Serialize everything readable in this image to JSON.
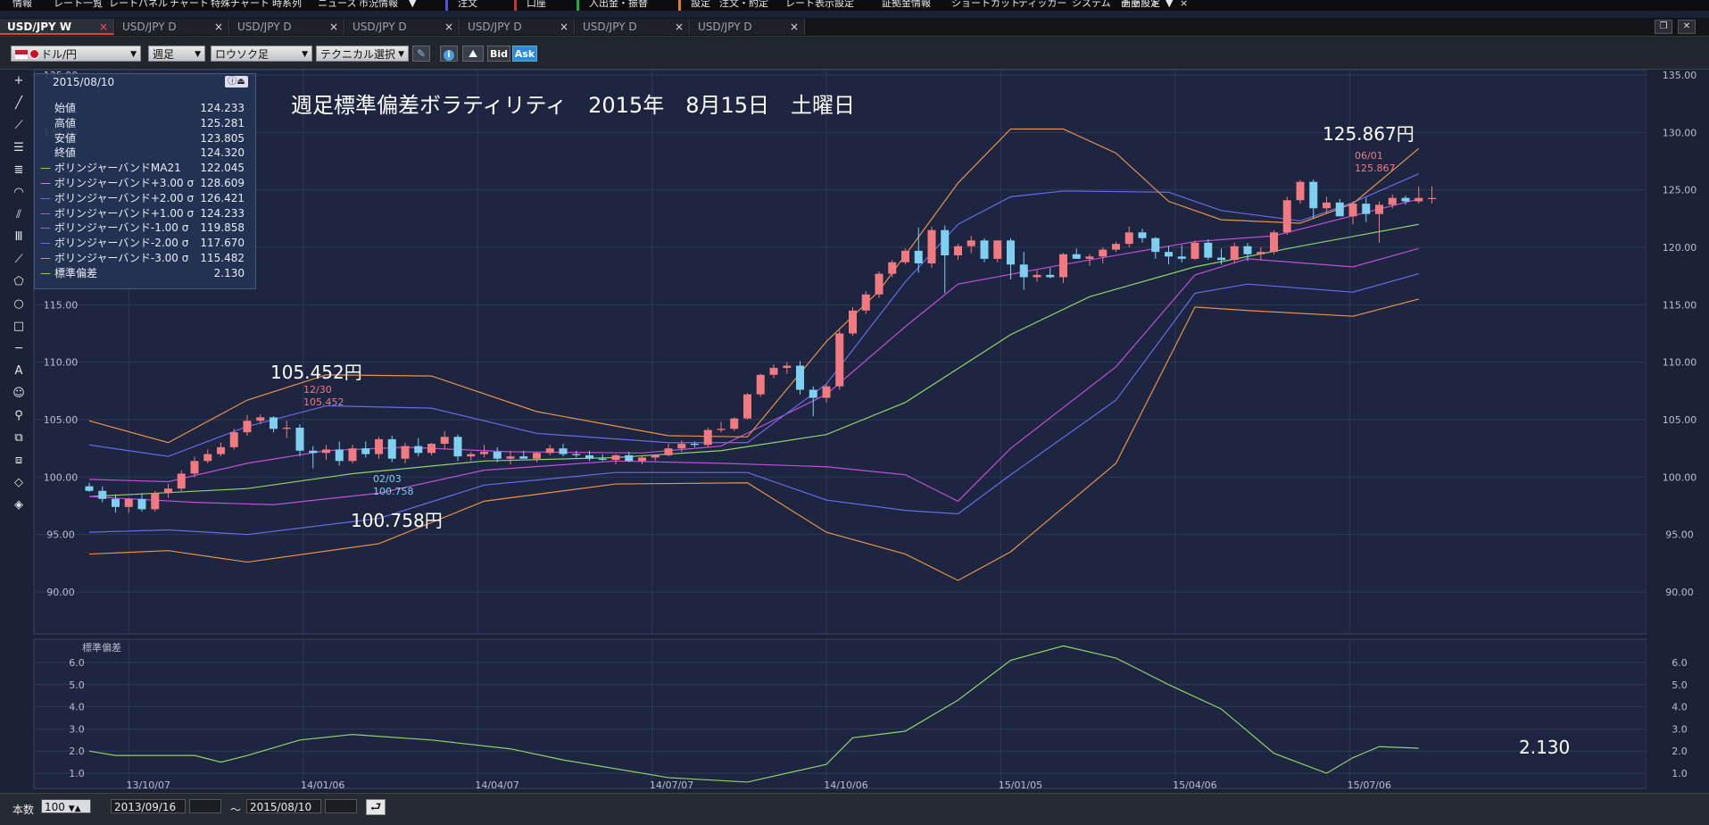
{
  "menu": {
    "items": [
      "情報",
      "レート一覧",
      "レートパネル",
      "チャート",
      "特殊チャート",
      "時系列",
      "ニュース",
      "市況情報",
      "▼",
      "注文",
      "口座",
      "入出金・振替",
      "設定",
      "注文・約定",
      "レート表示設定",
      "証拠金情報",
      "ショートカット",
      "ティッカー",
      "システム",
      "画面設定",
      "チャート",
      "▼"
    ],
    "close_icon": "×"
  },
  "tabs": [
    {
      "label": "USD/JPY W",
      "active": true
    },
    {
      "label": "USD/JPY D",
      "active": false
    },
    {
      "label": "USD/JPY D",
      "active": false
    },
    {
      "label": "USD/JPY D",
      "active": false
    },
    {
      "label": "USD/JPY D",
      "active": false
    },
    {
      "label": "USD/JPY D",
      "active": false
    },
    {
      "label": "USD/JPY D",
      "active": false
    }
  ],
  "tab_close": "×",
  "window_buttons": {
    "restore": "❐",
    "close": "✕"
  },
  "toolbar": {
    "pair": "ドル/円",
    "period": "週足",
    "chart_type": "ロウソク足",
    "technical": "テクニカル選択",
    "bid": "Bid",
    "ask": "Ask",
    "pencil_icon": "✎",
    "info_icon": "i",
    "area_icon": "⛰"
  },
  "tools": [
    "+",
    "╱",
    "⟋",
    "☰",
    "≣",
    "◠",
    "⫽",
    "Ⅲ",
    "⟋",
    "⬠",
    "○",
    "□",
    "─",
    "A",
    "☺",
    "⚲",
    "⧉",
    "⧈",
    "◇",
    "◈"
  ],
  "info_panel": {
    "date": "2015/08/10",
    "icons": "ⓘ⏏",
    "rows": [
      {
        "label": "始値",
        "value": "124.233",
        "dash": ""
      },
      {
        "label": "高値",
        "value": "125.281",
        "dash": ""
      },
      {
        "label": "安値",
        "value": "123.805",
        "dash": ""
      },
      {
        "label": "終値",
        "value": "124.320",
        "dash": ""
      },
      {
        "label": "ボリンジャーバンドMA21",
        "value": "122.045",
        "dash": "—",
        "color": "#9be06a"
      },
      {
        "label": "ボリンジャーバンド+3.00 σ",
        "value": "128.609",
        "dash": "—",
        "color": "#f0a050"
      },
      {
        "label": "ボリンジャーバンド+2.00 σ",
        "value": "126.421",
        "dash": "—",
        "color": "#7070f0"
      },
      {
        "label": "ボリンジャーバンド+1.00 σ",
        "value": "124.233",
        "dash": "—",
        "color": "#d050e0"
      },
      {
        "label": "ボリンジャーバンド-1.00 σ",
        "value": "119.858",
        "dash": "—",
        "color": "#d050e0"
      },
      {
        "label": "ボリンジャーバンド-2.00 σ",
        "value": "117.670",
        "dash": "—",
        "color": "#7070f0"
      },
      {
        "label": "ボリンジャーバンド-3.00 σ",
        "value": "115.482",
        "dash": "—",
        "color": "#f0a050"
      },
      {
        "label": "標準偏差",
        "value": "2.130",
        "dash": "—",
        "color": "#9be06a"
      }
    ]
  },
  "annotations": {
    "title": "週足標準偏差ボラティリティ　2015年　8月15日　土曜日",
    "high1_big": "105.452円",
    "high1_date": "12/30",
    "high1_val": "105.452",
    "low1_date": "02/03",
    "low1_val": "100.758",
    "low1_big": "100.758円",
    "high2_big": "125.867円",
    "high2_date": "06/01",
    "high2_val": "125.867",
    "stddev_big": "2.130"
  },
  "sub_chart_label": "標準偏差",
  "chart_data": {
    "type": "line",
    "instrument": "USD/JPY",
    "timeframe": "週足",
    "price_axis": {
      "min": 90,
      "max": 135,
      "ticks": [
        "135.00",
        "130.00",
        "125.00",
        "120.00",
        "115.00",
        "110.00",
        "105.00",
        "100.00",
        "95.00",
        "90.00"
      ],
      "tick_values": [
        135,
        130,
        125,
        120,
        115,
        110,
        105,
        100,
        95,
        90
      ]
    },
    "sub_axis": {
      "ticks": [
        "6.0",
        "5.0",
        "4.0",
        "3.0",
        "2.0",
        "1.0"
      ],
      "tick_values": [
        6,
        5,
        4,
        3,
        2,
        1
      ]
    },
    "x_labels": [
      "13/10/07",
      "14/01/06",
      "14/04/07",
      "14/07/07",
      "14/10/06",
      "15/01/05",
      "15/04/06",
      "15/07/06"
    ],
    "grid": true,
    "candles": [
      [
        99.2,
        99.5,
        98.7,
        98.8
      ],
      [
        98.8,
        99.2,
        97.8,
        98.1
      ],
      [
        98.1,
        98.5,
        96.9,
        97.4
      ],
      [
        97.4,
        98.2,
        96.9,
        98.1
      ],
      [
        98.1,
        98.6,
        97.0,
        97.2
      ],
      [
        97.2,
        98.8,
        97.0,
        98.6
      ],
      [
        98.6,
        99.4,
        98.2,
        99.0
      ],
      [
        99.0,
        100.6,
        98.8,
        100.3
      ],
      [
        100.3,
        101.8,
        100.0,
        101.4
      ],
      [
        101.4,
        102.4,
        101.2,
        102.0
      ],
      [
        102.0,
        103.0,
        101.8,
        102.6
      ],
      [
        102.6,
        104.2,
        102.4,
        103.9
      ],
      [
        103.9,
        105.4,
        103.6,
        104.9
      ],
      [
        104.9,
        105.452,
        104.6,
        105.2
      ],
      [
        105.2,
        105.3,
        103.9,
        104.2
      ],
      [
        104.2,
        104.9,
        103.4,
        104.3
      ],
      [
        104.3,
        104.6,
        101.8,
        102.3
      ],
      [
        102.3,
        102.7,
        100.758,
        102.1
      ],
      [
        102.1,
        102.8,
        101.5,
        102.4
      ],
      [
        102.4,
        103.1,
        101.0,
        101.4
      ],
      [
        101.4,
        102.8,
        101.2,
        102.5
      ],
      [
        102.5,
        103.1,
        101.7,
        102.0
      ],
      [
        102.0,
        103.5,
        101.6,
        103.3
      ],
      [
        103.3,
        103.6,
        101.3,
        101.6
      ],
      [
        101.6,
        103.0,
        101.2,
        102.7
      ],
      [
        102.7,
        103.4,
        101.8,
        102.1
      ],
      [
        102.1,
        103.0,
        101.9,
        102.9
      ],
      [
        102.9,
        104.0,
        102.4,
        103.5
      ],
      [
        103.5,
        103.7,
        101.4,
        101.8
      ],
      [
        101.8,
        102.2,
        101.4,
        102.0
      ],
      [
        102.0,
        102.8,
        101.7,
        102.2
      ],
      [
        102.2,
        102.6,
        101.3,
        101.6
      ],
      [
        101.6,
        102.3,
        101.1,
        101.8
      ],
      [
        101.8,
        102.3,
        101.6,
        101.6
      ],
      [
        101.6,
        102.2,
        101.3,
        102.1
      ],
      [
        102.1,
        102.8,
        101.9,
        102.5
      ],
      [
        102.5,
        102.9,
        101.8,
        102.0
      ],
      [
        102.0,
        102.3,
        101.7,
        101.9
      ],
      [
        101.9,
        102.3,
        101.4,
        101.6
      ],
      [
        101.6,
        102.0,
        101.4,
        101.5
      ],
      [
        101.5,
        102.0,
        101.1,
        101.9
      ],
      [
        101.9,
        102.2,
        101.3,
        101.4
      ],
      [
        101.4,
        101.9,
        101.1,
        101.7
      ],
      [
        101.7,
        102.0,
        101.4,
        101.9
      ],
      [
        101.9,
        102.9,
        101.8,
        102.5
      ],
      [
        102.5,
        103.2,
        102.2,
        102.9
      ],
      [
        102.9,
        103.1,
        102.6,
        102.8
      ],
      [
        102.8,
        104.3,
        102.6,
        104.1
      ],
      [
        104.1,
        104.8,
        103.9,
        104.2
      ],
      [
        104.2,
        105.2,
        104.0,
        105.1
      ],
      [
        105.1,
        107.3,
        105.0,
        107.2
      ],
      [
        107.2,
        109.0,
        107.0,
        108.9
      ],
      [
        108.9,
        109.8,
        108.6,
        109.5
      ],
      [
        109.5,
        110.0,
        109.0,
        109.7
      ],
      [
        109.7,
        110.1,
        107.2,
        107.6
      ],
      [
        107.6,
        107.9,
        105.3,
        106.9
      ],
      [
        106.9,
        108.1,
        106.5,
        107.9
      ],
      [
        107.9,
        112.8,
        107.6,
        112.5
      ],
      [
        112.5,
        114.8,
        112.3,
        114.5
      ],
      [
        114.5,
        116.2,
        114.2,
        115.9
      ],
      [
        115.9,
        117.9,
        115.6,
        117.7
      ],
      [
        117.7,
        118.9,
        117.4,
        118.7
      ],
      [
        118.7,
        119.9,
        118.5,
        119.7
      ],
      [
        119.7,
        121.7,
        117.8,
        118.6
      ],
      [
        118.6,
        121.8,
        118.2,
        121.5
      ],
      [
        121.5,
        121.9,
        116.0,
        119.3
      ],
      [
        119.3,
        120.3,
        118.9,
        120.1
      ],
      [
        120.1,
        121.0,
        119.5,
        120.6
      ],
      [
        120.6,
        120.8,
        118.7,
        119.0
      ],
      [
        119.0,
        120.6,
        118.7,
        120.6
      ],
      [
        120.6,
        120.8,
        117.2,
        118.5
      ],
      [
        118.5,
        119.6,
        116.3,
        117.4
      ],
      [
        117.4,
        118.0,
        117.0,
        117.6
      ],
      [
        117.6,
        118.2,
        117.3,
        117.4
      ],
      [
        117.4,
        119.5,
        116.9,
        119.4
      ],
      [
        119.4,
        119.9,
        119.0,
        119.0
      ],
      [
        119.0,
        119.4,
        118.4,
        119.2
      ],
      [
        119.2,
        120.0,
        118.6,
        119.8
      ],
      [
        119.8,
        120.5,
        119.6,
        120.3
      ],
      [
        120.3,
        121.8,
        120.0,
        121.3
      ],
      [
        121.3,
        121.6,
        120.4,
        120.8
      ],
      [
        120.8,
        120.9,
        119.0,
        119.6
      ],
      [
        119.6,
        120.1,
        118.5,
        119.2
      ],
      [
        119.2,
        120.2,
        118.7,
        119.0
      ],
      [
        119.0,
        120.6,
        118.9,
        120.4
      ],
      [
        120.4,
        120.7,
        118.9,
        119.1
      ],
      [
        119.1,
        119.9,
        118.5,
        118.9
      ],
      [
        118.9,
        120.4,
        118.6,
        120.1
      ],
      [
        120.1,
        120.4,
        118.8,
        119.4
      ],
      [
        119.4,
        120.0,
        118.9,
        119.6
      ],
      [
        119.6,
        121.5,
        119.4,
        121.3
      ],
      [
        121.3,
        124.4,
        121.1,
        124.1
      ],
      [
        124.1,
        125.867,
        123.8,
        125.7
      ],
      [
        125.7,
        125.9,
        122.5,
        123.4
      ],
      [
        123.4,
        124.4,
        122.9,
        123.9
      ],
      [
        123.9,
        124.2,
        122.7,
        122.7
      ],
      [
        122.7,
        124.0,
        122.0,
        123.8
      ],
      [
        123.8,
        124.3,
        122.2,
        122.9
      ],
      [
        122.9,
        124.0,
        120.4,
        123.7
      ],
      [
        123.7,
        124.6,
        123.4,
        124.3
      ],
      [
        124.3,
        124.5,
        123.7,
        124.0
      ],
      [
        124.0,
        125.3,
        123.8,
        124.3
      ],
      [
        124.2,
        125.3,
        123.8,
        124.3
      ]
    ],
    "bands": {
      "ma21": [
        [
          0,
          98.3
        ],
        [
          12,
          99.0
        ],
        [
          20,
          100.3
        ],
        [
          30,
          101.4
        ],
        [
          40,
          101.7
        ],
        [
          48,
          102.3
        ],
        [
          56,
          103.7
        ],
        [
          62,
          106.5
        ],
        [
          70,
          112.4
        ],
        [
          76,
          115.7
        ],
        [
          84,
          118.3
        ],
        [
          92,
          120.1
        ],
        [
          101,
          122.0
        ]
      ],
      "p1": [
        [
          0,
          99.8
        ],
        [
          6,
          99.6
        ],
        [
          12,
          101.2
        ],
        [
          18,
          102.3
        ],
        [
          24,
          102.6
        ],
        [
          32,
          102.2
        ],
        [
          42,
          102.1
        ],
        [
          48,
          102.7
        ],
        [
          56,
          107.2
        ],
        [
          62,
          113.1
        ],
        [
          66,
          116.8
        ],
        [
          74,
          118.5
        ],
        [
          84,
          120.5
        ],
        [
          90,
          121.0
        ],
        [
          101,
          124.2
        ]
      ],
      "p2": [
        [
          0,
          102.8
        ],
        [
          6,
          101.8
        ],
        [
          12,
          104.4
        ],
        [
          18,
          106.2
        ],
        [
          26,
          106.0
        ],
        [
          34,
          103.8
        ],
        [
          44,
          103.0
        ],
        [
          50,
          103.0
        ],
        [
          56,
          108.1
        ],
        [
          62,
          117.0
        ],
        [
          66,
          122.0
        ],
        [
          70,
          124.4
        ],
        [
          74,
          124.9
        ],
        [
          82,
          124.8
        ],
        [
          86,
          123.2
        ],
        [
          92,
          122.3
        ],
        [
          96,
          123.9
        ],
        [
          101,
          126.4
        ]
      ],
      "p3": [
        [
          0,
          104.9
        ],
        [
          6,
          103.0
        ],
        [
          12,
          106.7
        ],
        [
          18,
          108.9
        ],
        [
          26,
          108.8
        ],
        [
          34,
          105.7
        ],
        [
          44,
          103.6
        ],
        [
          50,
          103.5
        ],
        [
          56,
          111.8
        ],
        [
          60,
          116.2
        ],
        [
          66,
          125.6
        ],
        [
          70,
          130.3
        ],
        [
          74,
          130.3
        ],
        [
          78,
          128.2
        ],
        [
          82,
          124.0
        ],
        [
          86,
          122.4
        ],
        [
          92,
          122.1
        ],
        [
          96,
          123.8
        ],
        [
          101,
          128.6
        ]
      ],
      "m1": [
        [
          0,
          98.3
        ],
        [
          8,
          97.8
        ],
        [
          14,
          97.6
        ],
        [
          22,
          98.6
        ],
        [
          30,
          100.6
        ],
        [
          40,
          101.4
        ],
        [
          48,
          101.2
        ],
        [
          56,
          100.9
        ],
        [
          62,
          100.2
        ],
        [
          66,
          97.9
        ],
        [
          70,
          102.5
        ],
        [
          78,
          109.6
        ],
        [
          84,
          117.6
        ],
        [
          88,
          119.0
        ],
        [
          96,
          118.3
        ],
        [
          101,
          119.9
        ]
      ],
      "m2": [
        [
          0,
          95.2
        ],
        [
          6,
          95.4
        ],
        [
          12,
          95.0
        ],
        [
          22,
          96.4
        ],
        [
          30,
          99.3
        ],
        [
          40,
          100.4
        ],
        [
          50,
          100.4
        ],
        [
          56,
          98.0
        ],
        [
          62,
          97.1
        ],
        [
          66,
          96.8
        ],
        [
          70,
          100.2
        ],
        [
          78,
          106.7
        ],
        [
          84,
          116.0
        ],
        [
          88,
          116.8
        ],
        [
          96,
          116.1
        ],
        [
          101,
          117.7
        ]
      ],
      "m3": [
        [
          0,
          93.3
        ],
        [
          6,
          93.6
        ],
        [
          12,
          92.6
        ],
        [
          22,
          94.2
        ],
        [
          30,
          97.9
        ],
        [
          40,
          99.4
        ],
        [
          50,
          99.5
        ],
        [
          56,
          95.2
        ],
        [
          62,
          93.3
        ],
        [
          66,
          91.0
        ],
        [
          70,
          93.5
        ],
        [
          78,
          101.2
        ],
        [
          84,
          114.8
        ],
        [
          88,
          114.5
        ],
        [
          96,
          114.0
        ],
        [
          101,
          115.5
        ]
      ]
    },
    "stddev": [
      [
        0,
        2.0
      ],
      [
        2,
        1.8
      ],
      [
        8,
        1.8
      ],
      [
        10,
        1.5
      ],
      [
        12,
        1.8
      ],
      [
        16,
        2.5
      ],
      [
        20,
        2.75
      ],
      [
        26,
        2.5
      ],
      [
        32,
        2.1
      ],
      [
        36,
        1.6
      ],
      [
        44,
        0.8
      ],
      [
        50,
        0.6
      ],
      [
        56,
        1.4
      ],
      [
        58,
        2.6
      ],
      [
        62,
        2.9
      ],
      [
        66,
        4.3
      ],
      [
        70,
        6.1
      ],
      [
        74,
        6.75
      ],
      [
        78,
        6.2
      ],
      [
        82,
        5.0
      ],
      [
        86,
        3.9
      ],
      [
        90,
        1.9
      ],
      [
        94,
        1.0
      ],
      [
        96,
        1.7
      ],
      [
        98,
        2.2
      ],
      [
        101,
        2.13
      ]
    ]
  }
}
